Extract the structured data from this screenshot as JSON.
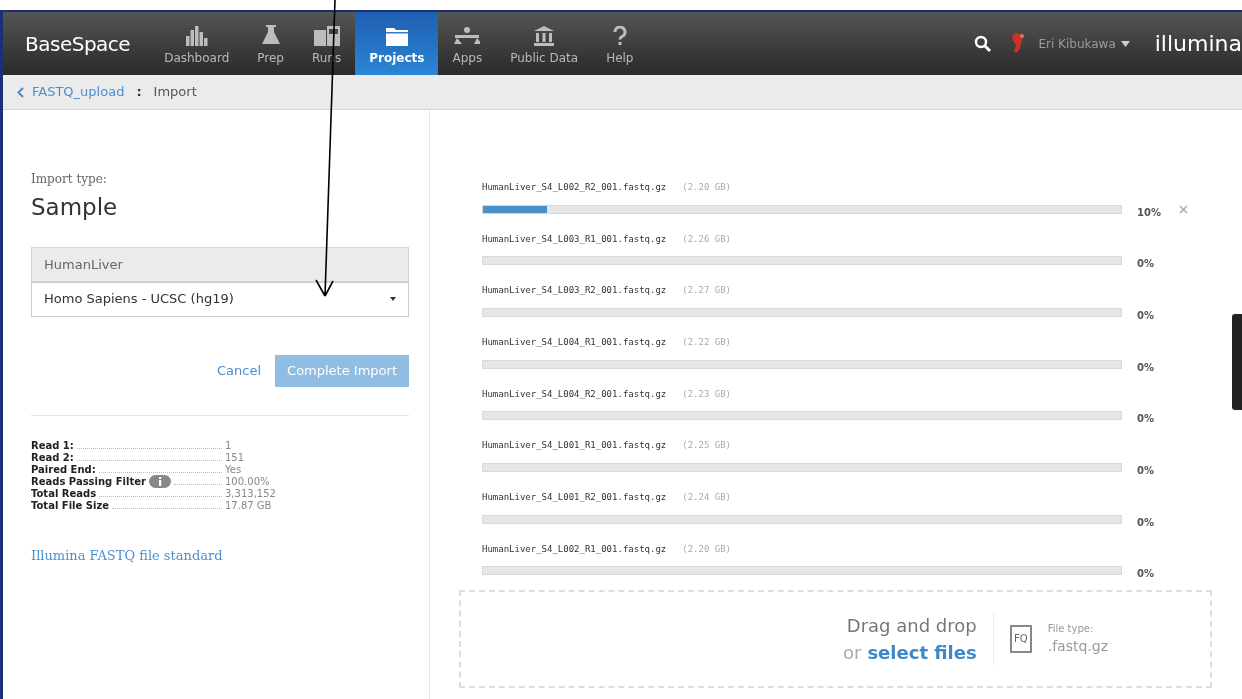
{
  "nav": {
    "logo": "BaseSpace",
    "items": [
      {
        "label": "Dashboard",
        "selected": false
      },
      {
        "label": "Prep",
        "selected": false
      },
      {
        "label": "Runs",
        "selected": false
      },
      {
        "label": "Projects",
        "selected": true
      },
      {
        "label": "Apps",
        "selected": false
      },
      {
        "label": "Public Data",
        "selected": false
      },
      {
        "label": "Help",
        "selected": false
      }
    ],
    "user": "Eri Kibukawa",
    "brand": "illumina"
  },
  "breadcrumb": {
    "parent": "FASTQ_upload",
    "separator": ":",
    "current": "Import"
  },
  "import": {
    "label": "Import type:",
    "type": "Sample",
    "name_value": "HumanLiver",
    "reference": "Homo Sapiens - UCSC (hg19)",
    "cancel": "Cancel",
    "submit": "Complete Import",
    "submit_disabled": true
  },
  "stats": [
    {
      "label": "Read 1:",
      "value": "1",
      "info": false
    },
    {
      "label": "Read 2:",
      "value": "151",
      "info": false
    },
    {
      "label": "Paired End:",
      "value": "Yes",
      "info": false
    },
    {
      "label": "Reads Passing Filter",
      "value": "100.00%",
      "info": true
    },
    {
      "label": "Total Reads",
      "value": "3,313,152",
      "info": false
    },
    {
      "label": "Total File Size",
      "value": "17.87 GB",
      "info": false
    }
  ],
  "standard_link": "Illumina FASTQ file standard",
  "files": [
    {
      "name": "HumanLiver_S4_L002_R2_001.fastq.gz",
      "size": "(2.20 GB)",
      "level": 0.1,
      "percent": "10%",
      "cancellable": true
    },
    {
      "name": "HumanLiver_S4_L003_R1_001.fastq.gz",
      "size": "(2.26 GB)",
      "level": 0,
      "percent": "0%",
      "cancellable": false
    },
    {
      "name": "HumanLiver_S4_L003_R2_001.fastq.gz",
      "size": "(2.27 GB)",
      "level": 0,
      "percent": "0%",
      "cancellable": false
    },
    {
      "name": "HumanLiver_S4_L004_R1_001.fastq.gz",
      "size": "(2.22 GB)",
      "level": 0,
      "percent": "0%",
      "cancellable": false
    },
    {
      "name": "HumanLiver_S4_L004_R2_001.fastq.gz",
      "size": "(2.23 GB)",
      "level": 0,
      "percent": "0%",
      "cancellable": false
    },
    {
      "name": "HumanLiver_S4_L001_R1_001.fastq.gz",
      "size": "(2.25 GB)",
      "level": 0,
      "percent": "0%",
      "cancellable": false
    },
    {
      "name": "HumanLiver_S4_L001_R2_001.fastq.gz",
      "size": "(2.24 GB)",
      "level": 0,
      "percent": "0%",
      "cancellable": false
    },
    {
      "name": "HumanLiver_S4_L002_R1_001.fastq.gz",
      "size": "(2.20 GB)",
      "level": 0,
      "percent": "0%",
      "cancellable": false
    }
  ],
  "dropzone": {
    "title": "Drag and drop",
    "or": "or",
    "link": "select files",
    "icon_text": "FQ",
    "type_label": "File type:",
    "type_value": ".fastq.gz"
  }
}
